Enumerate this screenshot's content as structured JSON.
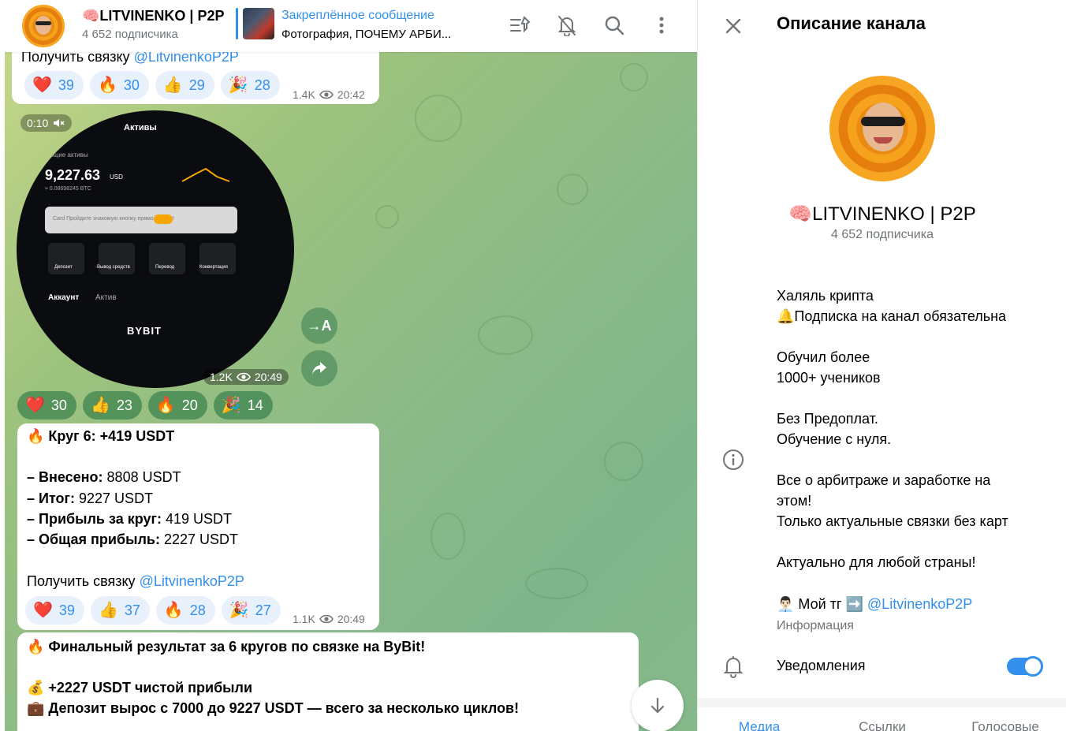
{
  "header": {
    "title": "🧠LITVINENKO | P2P",
    "subscribers": "4 652 подписчика",
    "pinned_label": "Закреплённое сообщение",
    "pinned_text": "Фотография, ПОЧЕМУ АРБИ..."
  },
  "messages": {
    "first": {
      "link_prefix": "Получить связку ",
      "link": "@LitvinenkoP2P",
      "reactions": [
        {
          "emoji": "❤️",
          "count": "39"
        },
        {
          "emoji": "🔥",
          "count": "30"
        },
        {
          "emoji": "👍",
          "count": "29"
        },
        {
          "emoji": "🎉",
          "count": "28"
        }
      ],
      "views": "1.4K",
      "time": "20:42"
    },
    "video": {
      "duration": "0:10",
      "screen_title": "Активы",
      "total_label": "Общие активы",
      "balance": "9,227.63",
      "currency": "USD",
      "btc": "≈ 0.08698245 BTC",
      "card_text": "Card  Пройдите знакомую  кнопку прямо сейчас!",
      "actions": [
        "Депозит",
        "Вывод средств",
        "Перевод",
        "Конвертация"
      ],
      "tab_account": "Аккаунт",
      "tab_asset": "Актив",
      "brand": "BYBIT",
      "views": "1.2K",
      "time": "20:49",
      "reactions": [
        {
          "emoji": "❤️",
          "count": "30"
        },
        {
          "emoji": "👍",
          "count": "23"
        },
        {
          "emoji": "🔥",
          "count": "20"
        },
        {
          "emoji": "🎉",
          "count": "14"
        }
      ]
    },
    "circle6": {
      "heading": "🔥 Круг 6: +419 USDT",
      "deposited_label": "– Внесено:",
      "deposited_value": " 8808 USDT",
      "total_label": "– Итог:",
      "total_value": " 9227 USDT",
      "profit_label": "– Прибыль за круг:",
      "profit_value": " 419 USDT",
      "overall_label": "– Общая прибыль:",
      "overall_value": " 2227 USDT",
      "link_prefix": "Получить связку ",
      "link": "@LitvinenkoP2P",
      "reactions": [
        {
          "emoji": "❤️",
          "count": "39"
        },
        {
          "emoji": "👍",
          "count": "37"
        },
        {
          "emoji": "🔥",
          "count": "28"
        },
        {
          "emoji": "🎉",
          "count": "27"
        }
      ],
      "views": "1.1K",
      "time": "20:49"
    },
    "final": {
      "line1": "🔥 Финальный результат за 6 кругов по связке на ByBit!",
      "line2": "💰 +2227 USDT чистой прибыли",
      "line3": "💼 Депозит вырос с 7000 до 9227 USDT — всего за несколько циклов!"
    }
  },
  "panel": {
    "title": "Описание канала",
    "name": "🧠LITVINENKO | P2P",
    "subscribers": "4 652 подписчика",
    "description": [
      "Халяль крипта",
      "🔔Подписка на канал обязательна",
      "",
      "Обучил более",
      "1000+ учеников",
      "",
      "Без Предоплат.",
      "Обучение с нуля.",
      "",
      "Все о арбитраже и заработке на",
      "этом!",
      "Только актуальные связки без карт",
      "",
      "Актуально для любой страны!",
      ""
    ],
    "contact_prefix": "👨🏻‍💼 Мой тг ➡️ ",
    "contact_link": "@LitvinenkoP2P",
    "info_label": "Информация",
    "notifications_label": "Уведомления",
    "notifications_on": true,
    "tabs": [
      "Медиа",
      "Ссылки",
      "Голосовые"
    ]
  },
  "colors": {
    "accent": "#3390ec",
    "secondary_text": "#707579",
    "chat_bg": "#8dbb87"
  }
}
